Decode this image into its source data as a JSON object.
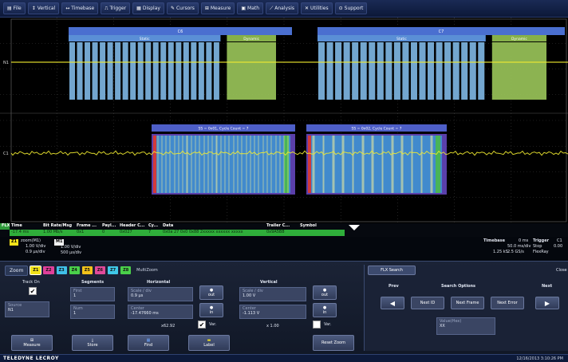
{
  "menu": [
    {
      "label": "File",
      "icon": "file-icon",
      "glyph": "▤"
    },
    {
      "label": "Vertical",
      "icon": "vertical-icon",
      "glyph": "↕"
    },
    {
      "label": "Timebase",
      "icon": "timebase-icon",
      "glyph": "↔"
    },
    {
      "label": "Trigger",
      "icon": "trigger-icon",
      "glyph": "⎍"
    },
    {
      "label": "Display",
      "icon": "display-icon",
      "glyph": "▦"
    },
    {
      "label": "Cursors",
      "icon": "cursors-icon",
      "glyph": "✎"
    },
    {
      "label": "Measure",
      "icon": "measure-icon",
      "glyph": "⊞"
    },
    {
      "label": "Math",
      "icon": "math-icon",
      "glyph": "▣"
    },
    {
      "label": "Analysis",
      "icon": "analysis-icon",
      "glyph": "⟋"
    },
    {
      "label": "Utilities",
      "icon": "utilities-icon",
      "glyph": "✕"
    },
    {
      "label": "Support",
      "icon": "support-icon",
      "glyph": "⊙"
    }
  ],
  "traces": {
    "upper": {
      "frames": [
        {
          "title": "C6",
          "static_label": "Static",
          "dynamic_label": "Dynamic"
        },
        {
          "title": "C7",
          "static_label": "Static",
          "dynamic_label": "Dynamic"
        }
      ],
      "channel_tag": "N1"
    },
    "lower": {
      "segments": [
        {
          "label": "SS = 0x01, Cycle Count = 7"
        },
        {
          "label": "SS = 0x02, Cycle Count = 7"
        }
      ],
      "channel_tag": "C1"
    }
  },
  "decode_table": {
    "headers": [
      "Time",
      "Bit Rate/Msg",
      "Frame ...",
      "Payl...",
      "Header C...",
      "Cy...",
      "Data",
      "Trailer C...",
      "Symbol"
    ],
    "row_tag": "FLX",
    "row": [
      "-17.4 ms",
      "1.00 Mb/s",
      "0x1",
      "0",
      "0x027",
      "7",
      "0x0a 27 0x0 0x88 2xxxxx xxxxxx xxxxx",
      "0x9A5B8",
      ""
    ]
  },
  "info": {
    "z1_badge": "Z1",
    "z1_title": "zoom(M1)",
    "z1_vdiv": "1.00 V/div",
    "z1_tdiv": "0.9 µs/div",
    "m1_badge": "M1",
    "m1_vdiv": "1.00 V/div",
    "m1_tdiv": "500 µs/div",
    "timebase_label": "Timebase",
    "timebase_offset": "0 ms",
    "timebase_rate": "50.0 ms/div",
    "timebase_samples": "1.25 kS",
    "timebase_srate": "2.5 GS/s",
    "trigger_label": "Trigger",
    "trigger_ch": "C1",
    "trigger_mode": "Stop",
    "trigger_level": "0.00",
    "trigger_type": "FlexRay"
  },
  "panel": {
    "zoom_label": "Zoom",
    "zoom_tabs": [
      {
        "label": "Z1",
        "color": "#f2e21a"
      },
      {
        "label": "Z2",
        "color": "#e0409a"
      },
      {
        "label": "Z3",
        "color": "#40c0e8"
      },
      {
        "label": "Z4",
        "color": "#4ad04a"
      },
      {
        "label": "Z5",
        "color": "#f2c21a"
      },
      {
        "label": "Z6",
        "color": "#e04a9a"
      },
      {
        "label": "Z7",
        "color": "#40c8e8"
      },
      {
        "label": "Z8",
        "color": "#4ad04a"
      }
    ],
    "multizoom": "MultiZoom",
    "track_on": "Track On",
    "source_label": "Source",
    "source_value": "N1",
    "segments_title": "Segments",
    "first_label": "First",
    "first_value": "1",
    "num_label": "Num",
    "num_value": "1",
    "horizontal_title": "Horizontal",
    "scale_label": "Scale / div",
    "scale_value": "0.9 µs",
    "center_label": "Center",
    "center_value": "-17.47660 ms",
    "h_factor": "x62.92",
    "var_label": "Var.",
    "vertical_title": "Vertical",
    "v_scale_label": "Scale / div",
    "v_scale_value": "1.00 V",
    "v_center_label": "Center",
    "v_center_value": "-1.113 V",
    "v_factor": "x 1.00",
    "v_var_label": "Var.",
    "out_label": "out",
    "in_label": "in",
    "measure_label": "Measure",
    "store_label": "Store",
    "find_label": "Find",
    "label_label": "Label",
    "reset_zoom": "Reset Zoom",
    "close_label": "Close"
  },
  "flx": {
    "tab": "FLX Search",
    "prev": "Prev",
    "options_title": "Search Options",
    "next": "Next",
    "next_id": "Next ID",
    "next_frame": "Next Frame",
    "next_error": "Next Error",
    "value_label": "Value(Hex)",
    "value": "XX"
  },
  "footer": {
    "brand": "TELEDYNE LECROY",
    "timestamp": "12/16/2013 3:10:26 PM"
  },
  "colors": {
    "static": "#7fb8e6",
    "dynamic": "#9bc75a",
    "frame_bar": "#4a6fd0",
    "segment_bar": "#4e5fc8",
    "trace": "#f0ea30",
    "decode_green": "#2fae3a"
  }
}
